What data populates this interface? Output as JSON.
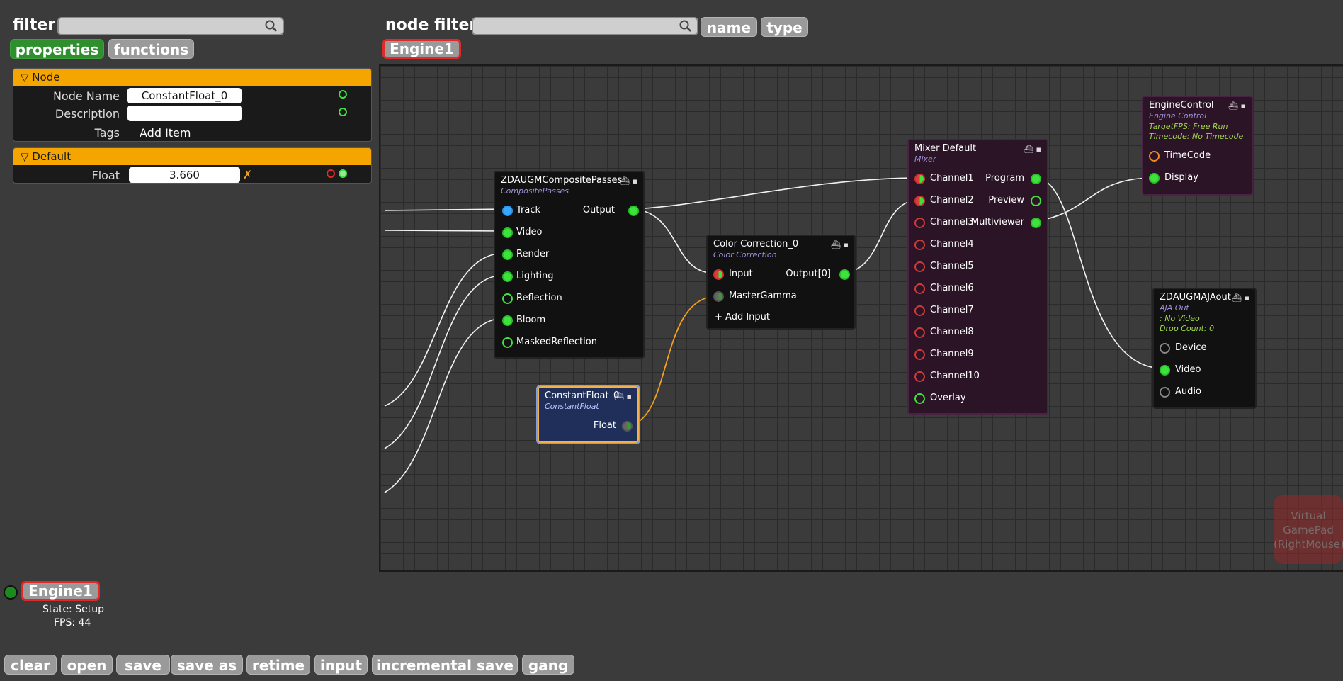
{
  "left_panel": {
    "filter_label": "filter",
    "filter_placeholder": "",
    "tabs": [
      "properties",
      "functions"
    ],
    "sections": {
      "node": {
        "title": "▽ Node",
        "node_name_label": "Node Name",
        "node_name_value": "ConstantFloat_0",
        "description_label": "Description",
        "description_value": "",
        "tags_label": "Tags",
        "add_item": "Add Item"
      },
      "default": {
        "title": "▽ Default",
        "float_label": "Float",
        "float_value": "3.660",
        "clear_glyph": "✗"
      }
    }
  },
  "top_bar": {
    "node_filter_label": "node filter",
    "node_filter_placeholder": "",
    "name_btn": "name",
    "type_btn": "type",
    "engine_tab": "Engine1"
  },
  "nodes": {
    "composite": {
      "title": "ZDAUGMCompositePasses",
      "subtitle": "CompositePasses",
      "inputs": [
        "Track",
        "Video",
        "Render",
        "Lighting",
        "Reflection",
        "Bloom",
        "MaskedReflection"
      ],
      "output": "Output"
    },
    "color": {
      "title": "Color Correction_0",
      "subtitle": "Color Correction",
      "inputs": [
        "Input",
        "MasterGamma"
      ],
      "add_input": "+ Add Input",
      "output": "Output[0]"
    },
    "constfloat": {
      "title": "ConstantFloat_0",
      "subtitle": "ConstantFloat",
      "output": "Float"
    },
    "mixer": {
      "title": "Mixer Default",
      "subtitle": "Mixer",
      "inputs": [
        "Channel1",
        "Channel2",
        "Channel3",
        "Channel4",
        "Channel5",
        "Channel6",
        "Channel7",
        "Channel8",
        "Channel9",
        "Channel10",
        "Overlay"
      ],
      "outputs": [
        "Program",
        "Preview",
        "Multiviewer"
      ]
    },
    "engine": {
      "title": "EngineControl",
      "subtitle": "Engine Control",
      "info1": "TargetFPS: Free Run",
      "info2": "Timecode: No Timecode",
      "inputs": [
        "TimeCode",
        "Display"
      ]
    },
    "aja": {
      "title": "ZDAUGMAJAout",
      "subtitle": "AJA Out",
      "info1": ": No Video",
      "info2": "Drop Count: 0",
      "inputs": [
        "Device",
        "Video",
        "Audio"
      ]
    }
  },
  "gamepad": [
    "Virtual",
    "GamePad",
    "(RightMouse)"
  ],
  "status": {
    "engine": "Engine1",
    "state": "State: Setup",
    "fps": "FPS: 44",
    "indicator_color": "#1e8a1e"
  },
  "toolbar": [
    "clear",
    "open",
    "save",
    "save as",
    "retime",
    "input",
    "incremental save",
    "gang"
  ]
}
